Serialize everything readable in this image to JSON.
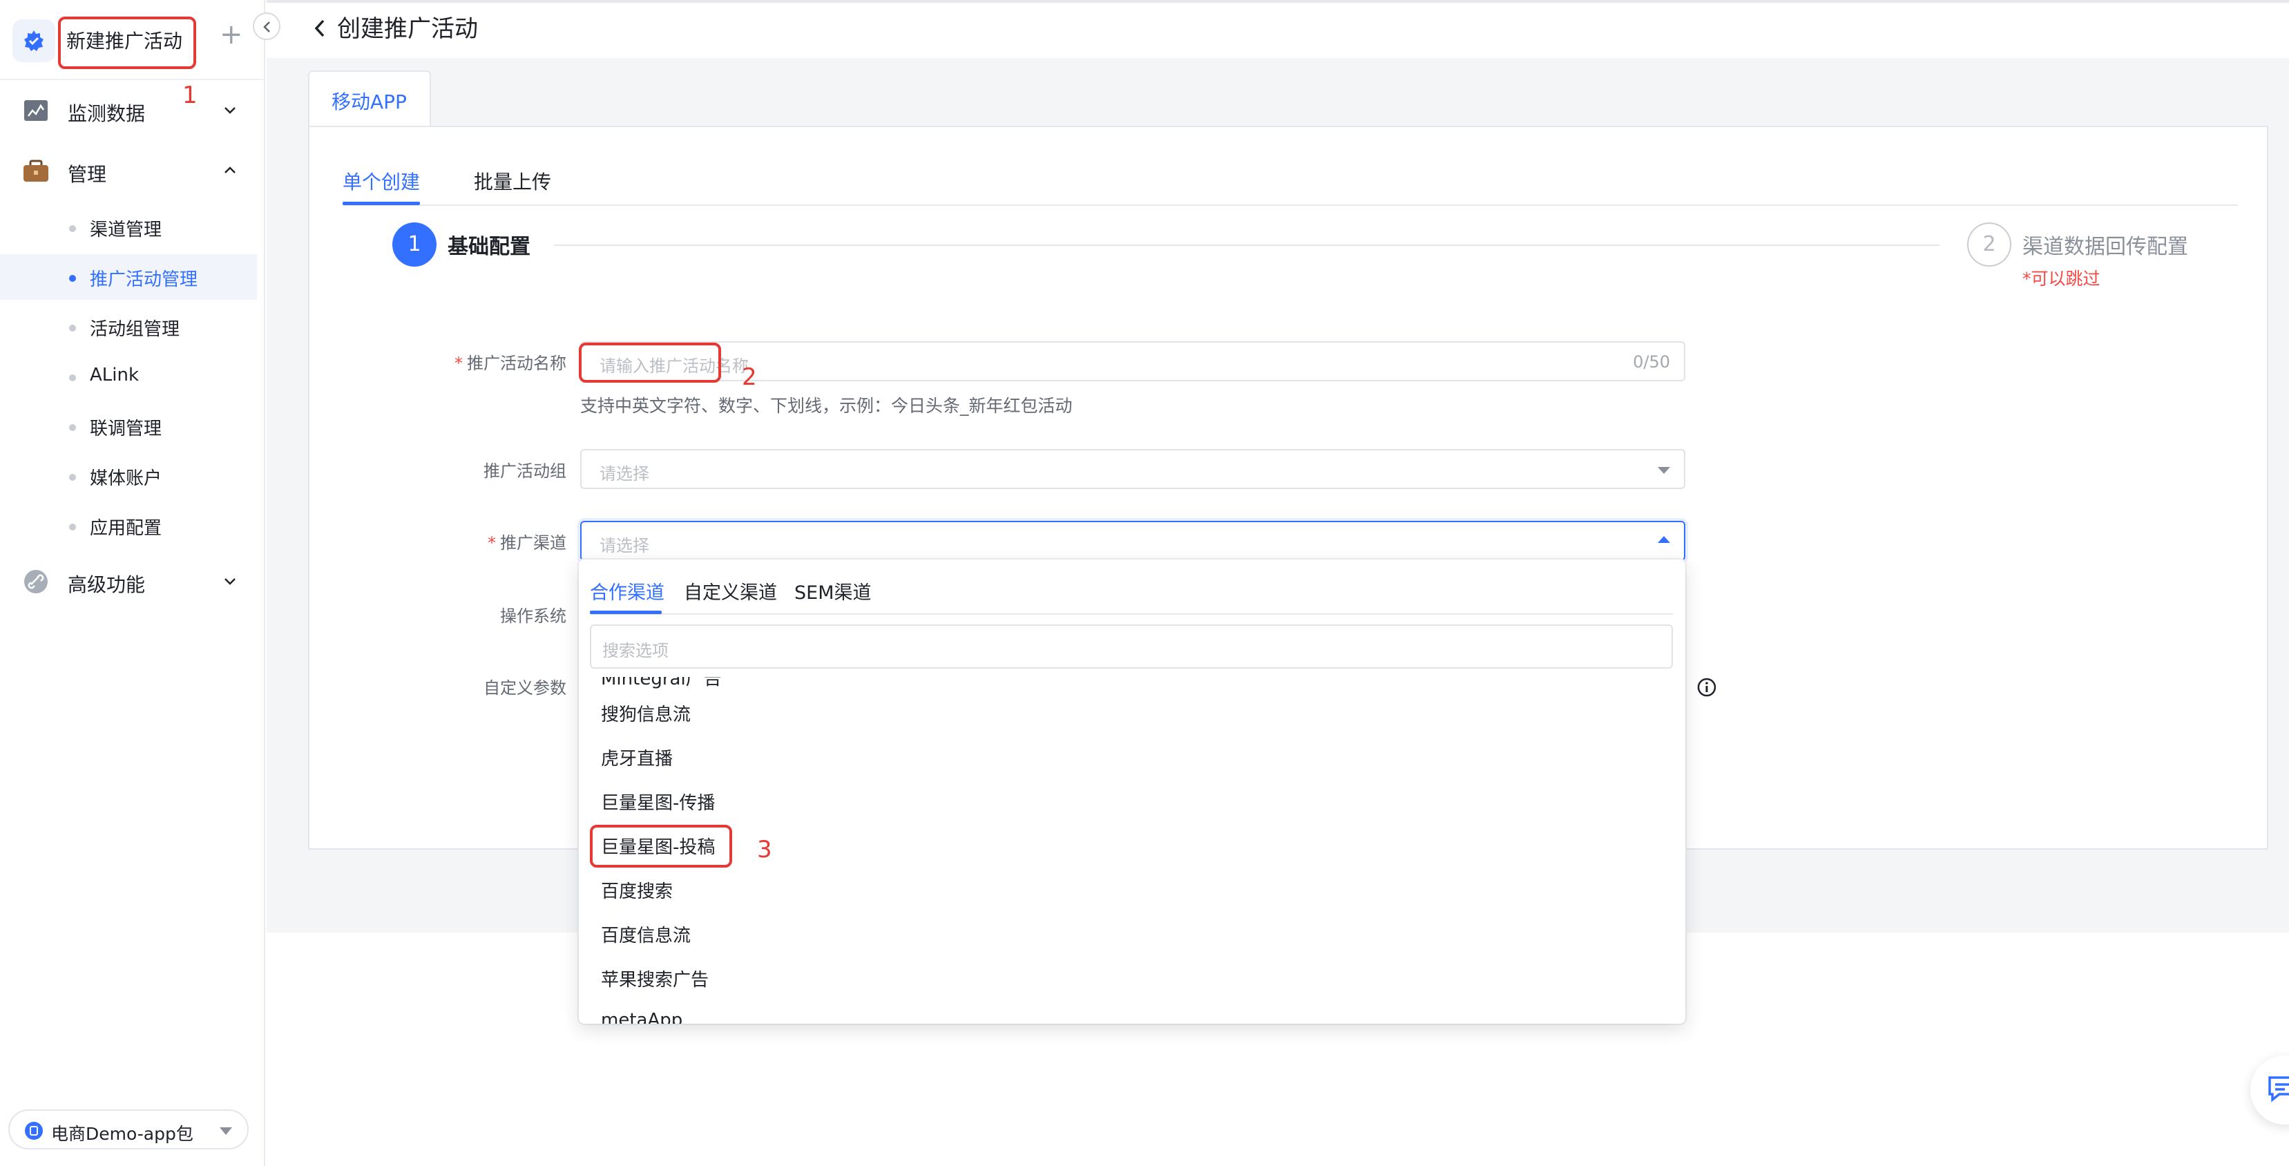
{
  "sidebar": {
    "title": "新建推广活动",
    "groups": {
      "monitor": "监测数据",
      "manage": "管理",
      "advanced": "高级功能"
    },
    "items": [
      "渠道管理",
      "推广活动管理",
      "活动组管理",
      "ALink",
      "联调管理",
      "媒体账户",
      "应用配置"
    ],
    "app_selector": "电商Demo-app包"
  },
  "header": {
    "title": "创建推广活动"
  },
  "tabs": {
    "platform": "移动APP",
    "single": "单个创建",
    "batch": "批量上传"
  },
  "steps": {
    "step1_num": "1",
    "step1_label": "基础配置",
    "step2_num": "2",
    "step2_label": "渠道数据回传配置",
    "step2_note": "*可以跳过"
  },
  "form": {
    "name_label": "推广活动名称",
    "name_placeholder": "请输入推广活动名称",
    "name_count": "0/50",
    "name_hint": "支持中英文字符、数字、下划线，示例：今日头条_新年红包活动",
    "group_label": "推广活动组",
    "group_placeholder": "请选择",
    "channel_label": "推广渠道",
    "channel_placeholder": "请选择",
    "os_label": "操作系统",
    "params_label": "自定义参数",
    "required_mark": "*"
  },
  "dropdown": {
    "tabs": [
      "合作渠道",
      "自定义渠道",
      "SEM渠道"
    ],
    "search_placeholder": "搜索选项",
    "items": [
      "Mintegral广告",
      "搜狗信息流",
      "虎牙直播",
      "巨量星图-传播",
      "巨量星图-投稿",
      "百度搜索",
      "百度信息流",
      "苹果搜索广告",
      "metaApp"
    ]
  },
  "annotations": [
    "1",
    "2",
    "3"
  ],
  "colors": {
    "accent": "#3370ff",
    "annotation": "#e53a34",
    "required": "#f54a45"
  }
}
